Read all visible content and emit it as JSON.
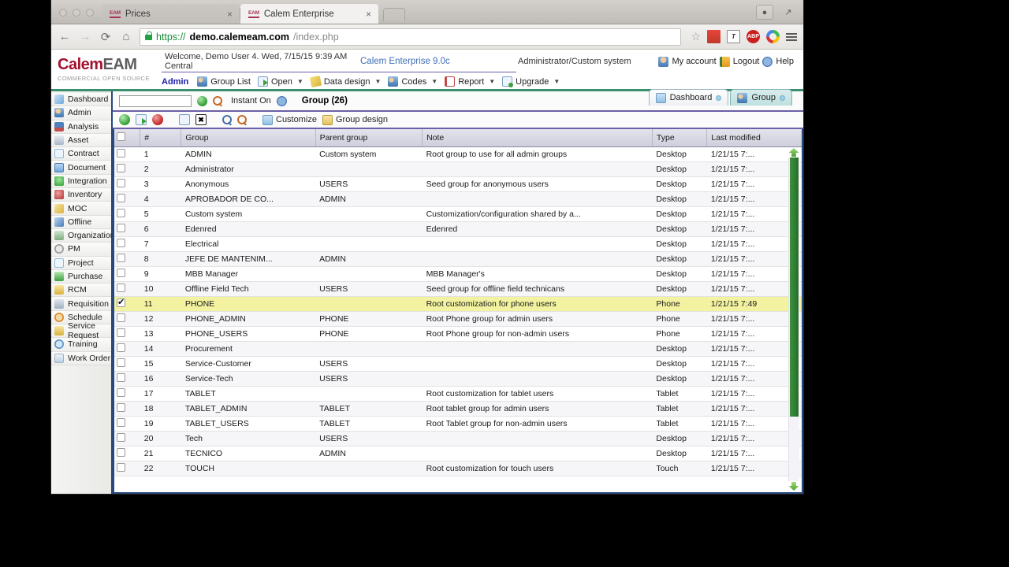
{
  "browser": {
    "tabs": [
      {
        "favicon": "EAM",
        "title": "Prices",
        "active": false
      },
      {
        "favicon": "EAM",
        "title": "Calem Enterprise",
        "active": true
      }
    ],
    "close_glyph": "×",
    "nav": {
      "back": "←",
      "forward": "→",
      "reload": "⟳",
      "home": "⌂"
    },
    "url": {
      "scheme": "https://",
      "host": "demo.calemeam.com",
      "path": "/index.php"
    },
    "star_glyph": "☆",
    "extensions": [
      "red-square-extension-icon",
      "t-box-extension-icon",
      "adblock-plus-icon",
      "color-circle-extension-icon"
    ],
    "abp_label": "ABP",
    "t_label": "T",
    "profile_glyph": "☺",
    "maximize_glyph": "↗"
  },
  "app": {
    "logo": {
      "brand_a": "Calem",
      "brand_b": "EAM",
      "tagline": "COMMERCIAL OPEN SOURCE"
    },
    "welcome": "Welcome, Demo User 4. Wed, 7/15/15 9:39 AM Central",
    "version": "Calem Enterprise 9.0c",
    "role": "Administrator/Custom system",
    "account_links": [
      {
        "label": "My account",
        "icon": "person-icon"
      },
      {
        "label": "Logout",
        "icon": "logout-icon"
      },
      {
        "label": "Help",
        "icon": "help-icon"
      }
    ],
    "menu": [
      {
        "label": "Admin",
        "icon": "",
        "caret": false
      },
      {
        "label": "Group List",
        "icon": "group-icon",
        "caret": false
      },
      {
        "label": "Open",
        "icon": "open-icon",
        "caret": true
      },
      {
        "label": "Data design",
        "icon": "pencil-icon",
        "caret": true
      },
      {
        "label": "Codes",
        "icon": "group-icon",
        "caret": true
      },
      {
        "label": "Report",
        "icon": "report-icon",
        "caret": true
      },
      {
        "label": "Upgrade",
        "icon": "upgrade-icon",
        "caret": true
      }
    ],
    "caret_glyph": "▼",
    "app_tabs": [
      {
        "label": "Dashboard",
        "selected": false
      },
      {
        "label": "Group",
        "selected": true
      }
    ]
  },
  "sidebar": {
    "items": [
      {
        "label": "Dashboard",
        "icon": "dashboard-icon",
        "color": "#7fb4e0"
      },
      {
        "label": "Admin",
        "icon": "admin-icon",
        "color": "#5f93c8"
      },
      {
        "label": "Analysis",
        "icon": "analysis-icon",
        "color": "#c0504d"
      },
      {
        "label": "Asset",
        "icon": "asset-icon",
        "color": "#a8b6c4"
      },
      {
        "label": "Contract",
        "icon": "contract-icon",
        "color": "#d8e6f2"
      },
      {
        "label": "Document",
        "icon": "document-icon",
        "color": "#6fa8dc"
      },
      {
        "label": "Integration",
        "icon": "integration-icon",
        "color": "#62b862"
      },
      {
        "label": "Inventory",
        "icon": "inventory-icon",
        "color": "#c0504d"
      },
      {
        "label": "MOC",
        "icon": "moc-icon",
        "color": "#e8c868"
      },
      {
        "label": "Offline",
        "icon": "offline-icon",
        "color": "#5f93c8"
      },
      {
        "label": "Organization",
        "icon": "organization-icon",
        "color": "#9ec49e"
      },
      {
        "label": "PM",
        "icon": "pm-icon",
        "color": "#a8a8a8"
      },
      {
        "label": "Project",
        "icon": "project-icon",
        "color": "#d8e6f2"
      },
      {
        "label": "Purchase",
        "icon": "purchase-icon",
        "color": "#62b862"
      },
      {
        "label": "RCM",
        "icon": "rcm-icon",
        "color": "#e8c868"
      },
      {
        "label": "Requisition",
        "icon": "requisition-icon",
        "color": "#b0bcc8"
      },
      {
        "label": "Schedule",
        "icon": "schedule-icon",
        "color": "#e8a050"
      },
      {
        "label": "Service Request",
        "icon": "service-request-icon",
        "color": "#e8c868"
      },
      {
        "label": "Training",
        "icon": "training-icon",
        "color": "#8fb8d8"
      },
      {
        "label": "Work Order",
        "icon": "work-order-icon",
        "color": "#c8d4e0"
      }
    ]
  },
  "filter": {
    "query_value": "",
    "query_placeholder": "",
    "apply_icon": "green-check-icon",
    "search_icon": "search-icon",
    "instant_label": "Instant On",
    "help_icon": "help-icon",
    "title": "Group (26)"
  },
  "toolbar": {
    "buttons": [
      {
        "name": "add-button",
        "icon": "add-icon",
        "label": ""
      },
      {
        "name": "copy-button",
        "icon": "copy-icon",
        "label": ""
      },
      {
        "name": "delete-button",
        "icon": "delete-icon",
        "label": ""
      },
      {
        "name": "refresh-button",
        "icon": "refresh-icon",
        "label": ""
      },
      {
        "name": "close-button",
        "icon": "x-icon",
        "label": "✖"
      },
      {
        "name": "search-button",
        "icon": "search-icon",
        "label": ""
      },
      {
        "name": "advanced-search-button",
        "icon": "search-orange-icon",
        "label": ""
      }
    ],
    "customize_label": "Customize",
    "group_design_label": "Group design"
  },
  "table": {
    "columns": [
      "",
      "#",
      "Group",
      "Parent group",
      "Note",
      "Type",
      "Last modified"
    ],
    "rows": [
      {
        "checked": false,
        "num": "1",
        "group": "ADMIN",
        "parent": "Custom system",
        "note": "Root group to use for all admin groups",
        "type": "Desktop",
        "modified": "1/21/15 7:..."
      },
      {
        "checked": false,
        "num": "2",
        "group": "Administrator",
        "parent": "",
        "note": "",
        "type": "Desktop",
        "modified": "1/21/15 7:..."
      },
      {
        "checked": false,
        "num": "3",
        "group": "Anonymous",
        "parent": "USERS",
        "note": "Seed group for anonymous users",
        "type": "Desktop",
        "modified": "1/21/15 7:..."
      },
      {
        "checked": false,
        "num": "4",
        "group": "APROBADOR DE CO...",
        "parent": "ADMIN",
        "note": "",
        "type": "Desktop",
        "modified": "1/21/15 7:..."
      },
      {
        "checked": false,
        "num": "5",
        "group": "Custom system",
        "parent": "",
        "note": "Customization/configuration shared by a...",
        "type": "Desktop",
        "modified": "1/21/15 7:..."
      },
      {
        "checked": false,
        "num": "6",
        "group": "Edenred",
        "parent": "",
        "note": "Edenred",
        "type": "Desktop",
        "modified": "1/21/15 7:..."
      },
      {
        "checked": false,
        "num": "7",
        "group": "Electrical",
        "parent": "",
        "note": "",
        "type": "Desktop",
        "modified": "1/21/15 7:..."
      },
      {
        "checked": false,
        "num": "8",
        "group": "JEFE DE MANTENIM...",
        "parent": "ADMIN",
        "note": "",
        "type": "Desktop",
        "modified": "1/21/15 7:..."
      },
      {
        "checked": false,
        "num": "9",
        "group": "MBB Manager",
        "parent": "",
        "note": "MBB Manager's",
        "type": "Desktop",
        "modified": "1/21/15 7:..."
      },
      {
        "checked": false,
        "num": "10",
        "group": "Offline Field Tech",
        "parent": "USERS",
        "note": "Seed group for offline field technicans",
        "type": "Desktop",
        "modified": "1/21/15 7:..."
      },
      {
        "checked": true,
        "num": "11",
        "group": "PHONE",
        "parent": "",
        "note": "Root customization for phone users",
        "type": "Phone",
        "modified": "1/21/15 7:49"
      },
      {
        "checked": false,
        "num": "12",
        "group": "PHONE_ADMIN",
        "parent": "PHONE",
        "note": "Root Phone group for admin users",
        "type": "Phone",
        "modified": "1/21/15 7:..."
      },
      {
        "checked": false,
        "num": "13",
        "group": "PHONE_USERS",
        "parent": "PHONE",
        "note": "Root Phone group for non-admin users",
        "type": "Phone",
        "modified": "1/21/15 7:..."
      },
      {
        "checked": false,
        "num": "14",
        "group": "Procurement",
        "parent": "",
        "note": "",
        "type": "Desktop",
        "modified": "1/21/15 7:..."
      },
      {
        "checked": false,
        "num": "15",
        "group": "Service-Customer",
        "parent": "USERS",
        "note": "",
        "type": "Desktop",
        "modified": "1/21/15 7:..."
      },
      {
        "checked": false,
        "num": "16",
        "group": "Service-Tech",
        "parent": "USERS",
        "note": "",
        "type": "Desktop",
        "modified": "1/21/15 7:..."
      },
      {
        "checked": false,
        "num": "17",
        "group": "TABLET",
        "parent": "",
        "note": "Root customization for tablet users",
        "type": "Tablet",
        "modified": "1/21/15 7:..."
      },
      {
        "checked": false,
        "num": "18",
        "group": "TABLET_ADMIN",
        "parent": "TABLET",
        "note": "Root tablet group for admin users",
        "type": "Tablet",
        "modified": "1/21/15 7:..."
      },
      {
        "checked": false,
        "num": "19",
        "group": "TABLET_USERS",
        "parent": "TABLET",
        "note": "Root Tablet group for non-admin users",
        "type": "Tablet",
        "modified": "1/21/15 7:..."
      },
      {
        "checked": false,
        "num": "20",
        "group": "Tech",
        "parent": "USERS",
        "note": "",
        "type": "Desktop",
        "modified": "1/21/15 7:..."
      },
      {
        "checked": false,
        "num": "21",
        "group": "TECNICO",
        "parent": "ADMIN",
        "note": "",
        "type": "Desktop",
        "modified": "1/21/15 7:..."
      },
      {
        "checked": false,
        "num": "22",
        "group": "TOUCH",
        "parent": "",
        "note": "Root customization for touch users",
        "type": "Touch",
        "modified": "1/21/15 7:..."
      }
    ]
  },
  "colors": {
    "accent_purple": "#6a5fa8",
    "border_blue": "#29487d",
    "selected_row": "#f2f2a0",
    "scrollbar_green": "#2e7d32",
    "brand_red": "#a3122e",
    "link_blue": "#3f6fb5"
  }
}
